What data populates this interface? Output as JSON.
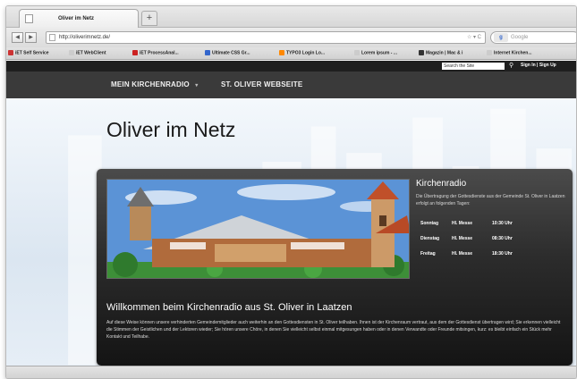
{
  "browser": {
    "tab_title": "Oliver im Netz",
    "new_tab_label": "+",
    "back_label": "◀",
    "forward_label": "▶",
    "url": "http://oliverimnetz.de/",
    "url_icons": "☆ ▾ C",
    "search_engine": "Google",
    "search_engine_logo": "g",
    "bookmarks": [
      {
        "label": "iET Self Service",
        "icon_color": "#cc3333"
      },
      {
        "label": "iET WebClient",
        "icon_color": "#cccccc"
      },
      {
        "label": "iET ProcessAnal...",
        "icon_color": "#cc2222"
      },
      {
        "label": "Ultimate CSS Gr...",
        "icon_color": "#3366cc"
      },
      {
        "label": "TYPO3 Login Lo...",
        "icon_color": "#ff8800"
      },
      {
        "label": "Lorem ipsum - ...",
        "icon_color": "#cccccc"
      },
      {
        "label": "Magazin | Mac & i",
        "icon_color": "#333333"
      },
      {
        "label": "Internet Kirchen...",
        "icon_color": "#cccccc"
      }
    ]
  },
  "site": {
    "search_placeholder": "Search the Site",
    "signin": "Sign In | Sign Up",
    "nav": [
      {
        "label": "MEIN KIRCHENRADIO",
        "arrow": "▾"
      },
      {
        "label": "ST. OLIVER WEBSEITE"
      }
    ],
    "title": "Oliver im Netz",
    "radio": {
      "title": "Kirchenradio",
      "description": "Die Übertragung der Gottesdienste aus der Gemeinde St. Oliver in Laatzen erfolgt an folgenden Tagen:",
      "schedule": [
        {
          "day": "Sonntag",
          "service": "Hl. Messe",
          "time": "10:30 Uhr"
        },
        {
          "day": "Dienstag",
          "service": "Hl. Messe",
          "time": "08:30 Uhr"
        },
        {
          "day": "Freitag",
          "service": "Hl. Messe",
          "time": "18:30 Uhr"
        }
      ]
    },
    "welcome": {
      "title": "Willkommen beim Kirchenradio aus St. Oliver in Laatzen",
      "text": "Auf diese Weise können unsere verhinderten Gemeindemitglieder auch weiterhin an den Gottesdiensten in St. Oliver teilhaben. Ihnen ist der Kirchenraum vertraut, aus dem der Gottesdienst übertragen wird; Sie erkennen vielleicht die Stimmen der Geistlichen und der Lektoren wieder; Sie hören unsere Chöre, in denen Sie vielleicht selbst einmal mitgesungen haben oder in denen Verwandte oder Freunde mitsingen, kurz: es bleibt einfach ein Stück mehr Kontakt und Teilhabe."
    }
  }
}
